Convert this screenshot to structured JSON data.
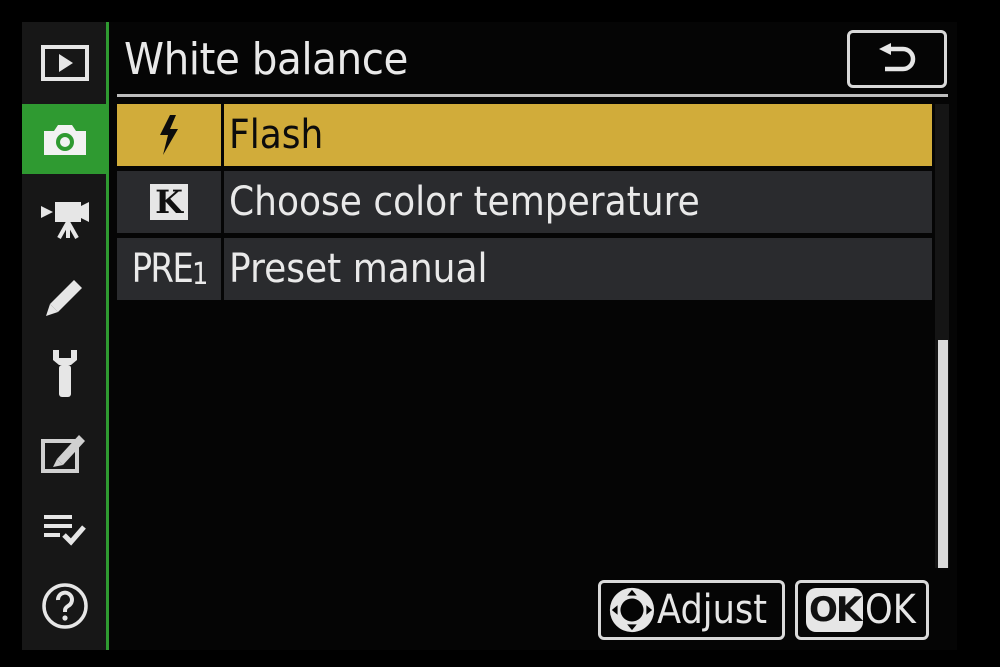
{
  "header": {
    "title": "White balance",
    "back_icon": "return-arrow-icon"
  },
  "sidebar": {
    "items": [
      {
        "name": "playback-menu",
        "icon": "playback-icon",
        "active": false
      },
      {
        "name": "photo-shooting-menu",
        "icon": "camera-icon",
        "active": true
      },
      {
        "name": "movie-shooting-menu",
        "icon": "movie-camera-icon",
        "active": false
      },
      {
        "name": "custom-settings-menu",
        "icon": "pencil-icon",
        "active": false
      },
      {
        "name": "setup-menu",
        "icon": "wrench-icon",
        "active": false
      },
      {
        "name": "retouch-menu",
        "icon": "retouch-icon",
        "active": false
      },
      {
        "name": "my-menu",
        "icon": "checklist-icon",
        "active": false
      },
      {
        "name": "help",
        "icon": "help-icon",
        "active": false
      }
    ]
  },
  "list": {
    "items": [
      {
        "icon": "flash-icon",
        "icon_text": "",
        "label": "Flash",
        "selected": true
      },
      {
        "icon": "kelvin-icon",
        "icon_text": "K",
        "label": "Choose color temperature",
        "selected": false
      },
      {
        "icon": "preset-icon",
        "icon_text": "PRE",
        "icon_sub": "1",
        "label": "Preset manual",
        "selected": false
      }
    ]
  },
  "footer": {
    "adjust_label": "Adjust",
    "ok_badge": "OK",
    "ok_label": "OK"
  },
  "colors": {
    "accent_green": "#2f9a31",
    "highlight_yellow": "#d1ac3a",
    "row_background": "#2a2b2e"
  }
}
